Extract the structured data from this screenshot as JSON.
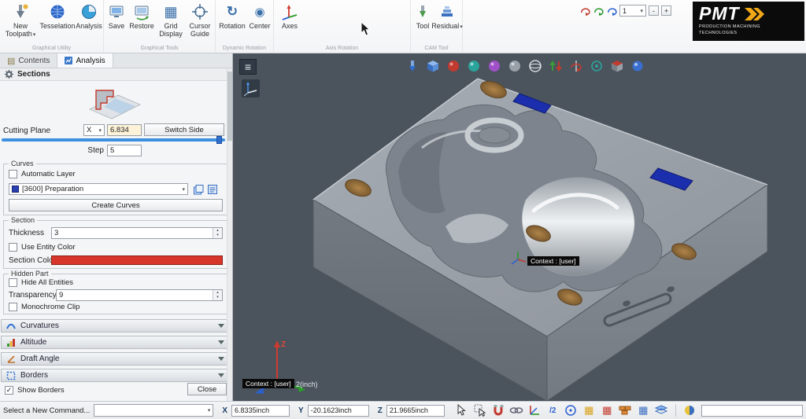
{
  "icons": {
    "dropdown_arrow": "▾",
    "spinner_up": "▴",
    "spinner_down": "▾",
    "check": "✓",
    "hamburger": "≡",
    "minus": "-",
    "plus": "+",
    "contents_tab": "▤",
    "grid": "▦",
    "rotate": "↻",
    "center": "◉",
    "half": "/2"
  },
  "ribbon": {
    "buttons": {
      "new_toolpath": "New Toolpath",
      "tesselation": "Tesselation",
      "analysis": "Analysis",
      "save": "Save",
      "restore": "Restore",
      "grid_display": "Grid Display",
      "cursor_guide": "Cursor Guide",
      "rotation": "Rotation",
      "center": "Center",
      "axes": "Axes",
      "tool": "Tool",
      "residual": "Residual"
    },
    "group_labels": {
      "graphical_utility": "Graphical Utility",
      "graphical_tools": "Graphical Tools",
      "dynamic_rotation": "Dynamic Rotation",
      "axis_rotation": "Axis Rotation",
      "cam_tool": "CAM Tool"
    },
    "axis_spinner": {
      "value": "1"
    },
    "logo": {
      "title": "PMT",
      "line1": "PRODUCTION MACHINING",
      "line2": "TECHNOLOGIES"
    }
  },
  "panel": {
    "tabs": {
      "contents": "Contents",
      "analysis": "Analysis"
    },
    "sections_title": "Sections",
    "cutting_plane": {
      "label": "Cutting Plane",
      "axis": "X",
      "value": "6.834",
      "switch_side": "Switch Side"
    },
    "step": {
      "label": "Step",
      "value": "5"
    },
    "curves": {
      "title": "Curves",
      "automatic_layer": "Automatic Layer",
      "layer": "[3600] Preparation",
      "create_curves": "Create Curves"
    },
    "section": {
      "title": "Section",
      "thickness_label": "Thickness",
      "thickness_value": "3",
      "use_entity_color": "Use Entity Color",
      "color_label": "Section Color",
      "color": "#d8352a"
    },
    "hidden_part": {
      "title": "Hidden Part",
      "hide_all": "Hide All Entities",
      "transparency_label": "Transparency",
      "transparency_value": "9",
      "monochrome": "Monochrome Clip"
    },
    "bars": {
      "curvatures": "Curvatures",
      "altitude": "Altitude",
      "draft_angle": "Draft Angle",
      "borders": "Borders"
    },
    "show_borders": "Show Borders",
    "close": "Close"
  },
  "viewport": {
    "context_marker": "Context : [user]",
    "context_origin": "Context : [user]",
    "unit_scale": "2(inch)",
    "z_axis": "Z"
  },
  "statusbar": {
    "command_label": "Select a New Command...",
    "x_label": "X",
    "x_value": "6.8335inch",
    "y_label": "Y",
    "y_value": "-20.1623inch",
    "z_label": "Z",
    "z_value": "21.9665inch"
  }
}
